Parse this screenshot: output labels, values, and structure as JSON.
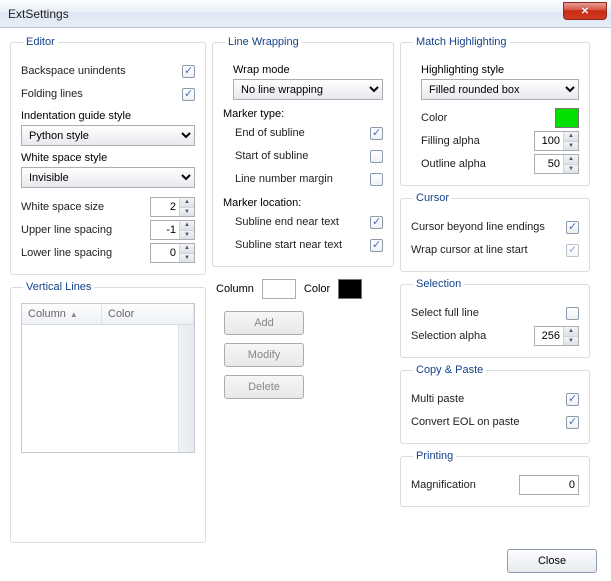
{
  "window": {
    "title": "ExtSettings"
  },
  "editor": {
    "legend": "Editor",
    "backspace_label": "Backspace unindents",
    "backspace_checked": true,
    "folding_label": "Folding lines",
    "folding_checked": true,
    "indent_guide_label": "Indentation guide style",
    "indent_guide_value": "Python style",
    "whitespace_style_label": "White space style",
    "whitespace_style_value": "Invisible",
    "whitespace_size_label": "White space size",
    "whitespace_size_value": "2",
    "upper_spacing_label": "Upper line spacing",
    "upper_spacing_value": "-1",
    "lower_spacing_label": "Lower line spacing",
    "lower_spacing_value": "0"
  },
  "vlines": {
    "legend": "Vertical Lines",
    "col_column": "Column",
    "col_color": "Color"
  },
  "linewrap": {
    "legend": "Line Wrapping",
    "wrap_mode_label": "Wrap mode",
    "wrap_mode_value": "No line wrapping",
    "marker_type_label": "Marker type:",
    "end_subline_label": "End of subline",
    "end_subline_checked": true,
    "start_subline_label": "Start of subline",
    "start_subline_checked": false,
    "line_num_margin_label": "Line number margin",
    "line_num_margin_checked": false,
    "marker_location_label": "Marker location:",
    "subline_end_near_label": "Subline end near text",
    "subline_end_near_checked": true,
    "subline_start_near_label": "Subline start near text",
    "subline_start_near_checked": true
  },
  "vline_edit": {
    "column_label": "Column",
    "color_label": "Color",
    "color_value": "#000000",
    "add_label": "Add",
    "modify_label": "Modify",
    "delete_label": "Delete"
  },
  "match": {
    "legend": "Match Highlighting",
    "style_label": "Highlighting style",
    "style_value": "Filled rounded box",
    "color_label": "Color",
    "color_value": "#00e000",
    "fill_alpha_label": "Filling alpha",
    "fill_alpha_value": "100",
    "outline_alpha_label": "Outline alpha",
    "outline_alpha_value": "50"
  },
  "cursor": {
    "legend": "Cursor",
    "beyond_label": "Cursor beyond line endings",
    "beyond_checked": true,
    "wrap_label": "Wrap cursor at line start",
    "wrap_checked": true
  },
  "selection": {
    "legend": "Selection",
    "full_line_label": "Select full line",
    "full_line_checked": false,
    "alpha_label": "Selection alpha",
    "alpha_value": "256"
  },
  "copypaste": {
    "legend": "Copy & Paste",
    "multi_label": "Multi paste",
    "multi_checked": true,
    "eol_label": "Convert EOL on paste",
    "eol_checked": true
  },
  "printing": {
    "legend": "Printing",
    "mag_label": "Magnification",
    "mag_value": "0"
  },
  "buttons": {
    "close": "Close"
  }
}
